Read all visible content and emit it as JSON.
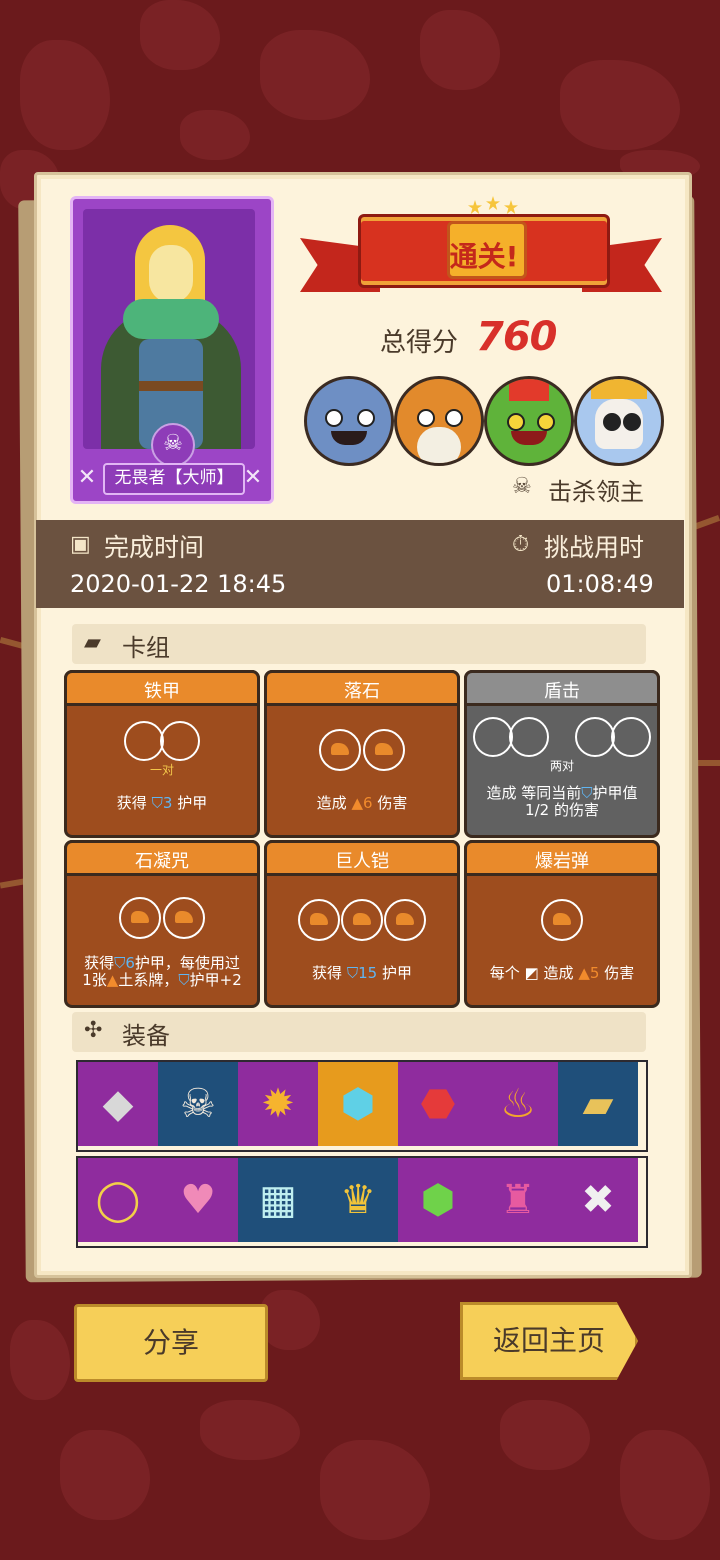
{
  "colors": {
    "background": "#6b1a1c",
    "panel": "#fdf3dc",
    "time_bar": "#6b5240",
    "score": "#d8302a",
    "card_orange": "#e98a2b",
    "card_gray": "#8e8e8e"
  },
  "hero": {
    "name": "无畏者【大师】",
    "emblem_icon": "skull-crossbones-icon"
  },
  "result": {
    "banner": "通关!",
    "score_label": "总得分",
    "score_value": "760"
  },
  "bosses": [
    {
      "icon": "blue-ogre-boss-icon"
    },
    {
      "icon": "bearded-wizard-boss-icon"
    },
    {
      "icon": "goblin-king-boss-icon"
    },
    {
      "icon": "skeleton-lord-boss-icon"
    }
  ],
  "kill_label": "击杀领主",
  "time": {
    "finish_label": "完成时间",
    "finish_value": "2020-01-22 18:45",
    "duration_label": "挑战用时",
    "duration_value": "01:08:49"
  },
  "deck": {
    "title": "卡组",
    "cards": [
      {
        "name": "铁甲",
        "pair": "一对",
        "desc_pre": "获得",
        "num": "3",
        "desc_post": "护甲"
      },
      {
        "name": "落石",
        "desc_pre": "造成",
        "num": "6",
        "desc_post": "伤害"
      },
      {
        "name": "盾击",
        "pair": "两对",
        "desc_line1": "造成 等同当前",
        "desc_line1b": "护甲值",
        "desc_line2": "1/2 的伤害"
      },
      {
        "name": "石凝咒",
        "desc_line1a": "获得",
        "num1": "6",
        "desc_line1b": "护甲，每使用过",
        "desc_line2a": "1张",
        "desc_line2b": "土系牌，",
        "desc_line2c": "护甲+2"
      },
      {
        "name": "巨人铠",
        "desc_pre": "获得",
        "num": "15",
        "desc_post": "护甲"
      },
      {
        "name": "爆岩弹",
        "desc_pre": "每个",
        "desc_mid": "造成",
        "num": "5",
        "desc_post": "伤害"
      }
    ]
  },
  "equipment": {
    "title": "装备",
    "row1": [
      {
        "icon": "gray-crystal-icon",
        "bg": "purple"
      },
      {
        "icon": "skull-dagger-icon",
        "bg": "blue"
      },
      {
        "icon": "flame-rock-icon",
        "bg": "purple"
      },
      {
        "icon": "blue-gem-icon",
        "bg": "orange"
      },
      {
        "icon": "red-ruby-icon",
        "bg": "purple"
      },
      {
        "icon": "fire-bottle-icon",
        "bg": "purple"
      },
      {
        "icon": "golden-scroll-icon",
        "bg": "blue"
      }
    ],
    "row2": [
      {
        "icon": "gold-ring-icon",
        "bg": "purple"
      },
      {
        "icon": "heart-amulet-icon",
        "bg": "purple"
      },
      {
        "icon": "sugar-box-icon",
        "bg": "blue"
      },
      {
        "icon": "gold-crown-icon",
        "bg": "blue"
      },
      {
        "icon": "green-emerald-icon",
        "bg": "purple"
      },
      {
        "icon": "totem-icon",
        "bg": "purple"
      },
      {
        "icon": "cursed-scroll-icon",
        "bg": "purple"
      }
    ]
  },
  "buttons": {
    "share": "分享",
    "home": "返回主页"
  }
}
